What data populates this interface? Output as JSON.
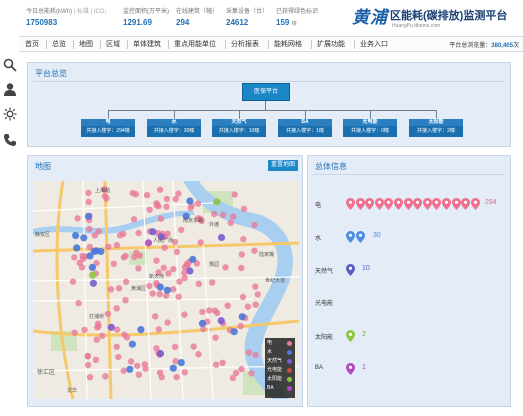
{
  "header": {
    "stats": [
      {
        "label": "今日总能耗(kWh)",
        "unit_extra": " | 标煤 | tCO₂",
        "value": "1750983",
        "value_unit": ""
      },
      {
        "label": "监控面积(万平米)",
        "unit_extra": "",
        "value": "1291.69",
        "value_unit": ""
      },
      {
        "label": "在线建筑（幢）",
        "unit_extra": "",
        "value": "294",
        "value_unit": ""
      },
      {
        "label": "采集设备（台）",
        "unit_extra": "",
        "value": "24612",
        "value_unit": ""
      },
      {
        "label": "已获得绿色标识",
        "unit_extra": "",
        "value": "159",
        "value_unit": "幢"
      }
    ],
    "brand_logo": "黄浦",
    "brand_title": "区能耗(碳排放)监测平台",
    "brand_url": "HuangPu.ttbems.com"
  },
  "nav": {
    "items": [
      "首页",
      "总览",
      "地图",
      "区域",
      "单体建筑",
      "重点用能单位",
      "分析报表",
      "能耗网格",
      "扩展功能",
      "业务入口"
    ],
    "visits_label": "平台总浏览量：",
    "visits_value": "380,405",
    "visits_unit": "次"
  },
  "sidebar": {
    "icons": [
      "search-icon",
      "user-icon",
      "sun-icon",
      "phone-icon"
    ]
  },
  "overview": {
    "title": "平台总览",
    "root": "医保平台",
    "children": [
      {
        "name": "电",
        "desc": "共接入楼宇：294幢"
      },
      {
        "name": "水",
        "desc": "共接入楼宇：30幢"
      },
      {
        "name": "天然气",
        "desc": "共接入楼宇：10幢"
      },
      {
        "name": "BA",
        "desc": "共接入楼宇：1幢"
      },
      {
        "name": "光电能",
        "desc": "共接入楼宇：0幢"
      },
      {
        "name": "太阳能",
        "desc": "共接入楼宇：2幢"
      }
    ]
  },
  "map": {
    "title": "地图",
    "button": "重置地图",
    "legend": [
      {
        "name": "电",
        "color": "#e87a9a"
      },
      {
        "name": "水",
        "color": "#4a78d8"
      },
      {
        "name": "天然气",
        "color": "#7a5cd0"
      },
      {
        "name": "光电能",
        "color": "#c84848"
      },
      {
        "name": "太阳能",
        "color": "#8cc63e"
      },
      {
        "name": "BA",
        "color": "#b04ac0"
      }
    ],
    "place_labels": [
      "静安区",
      "黄浦区",
      "徐汇区",
      "上海站",
      "人民广场",
      "外滩",
      "新天地",
      "打浦桥",
      "陆家嘴",
      "世纪大道",
      "南京东路",
      "豫园",
      "龙华"
    ]
  },
  "info": {
    "title": "总体信息",
    "rows": [
      {
        "label": "电",
        "count": "294",
        "color": "#f06e8e",
        "icons": 14
      },
      {
        "label": "水",
        "count": "30",
        "color": "#4a8ee0",
        "icons": 2
      },
      {
        "label": "天然气",
        "count": "10",
        "color": "#5a5ec0",
        "icons": 1
      },
      {
        "label": "光电能",
        "count": "",
        "color": "#c84848",
        "icons": 0
      },
      {
        "label": "太阳能",
        "count": "2",
        "color": "#8cc63e",
        "icons": 1
      },
      {
        "label": "BA",
        "count": "1",
        "color": "#b04ac0",
        "icons": 1
      }
    ]
  },
  "colors": {
    "accent": "#1b86c6",
    "panel_bg": "#e4edf7"
  }
}
